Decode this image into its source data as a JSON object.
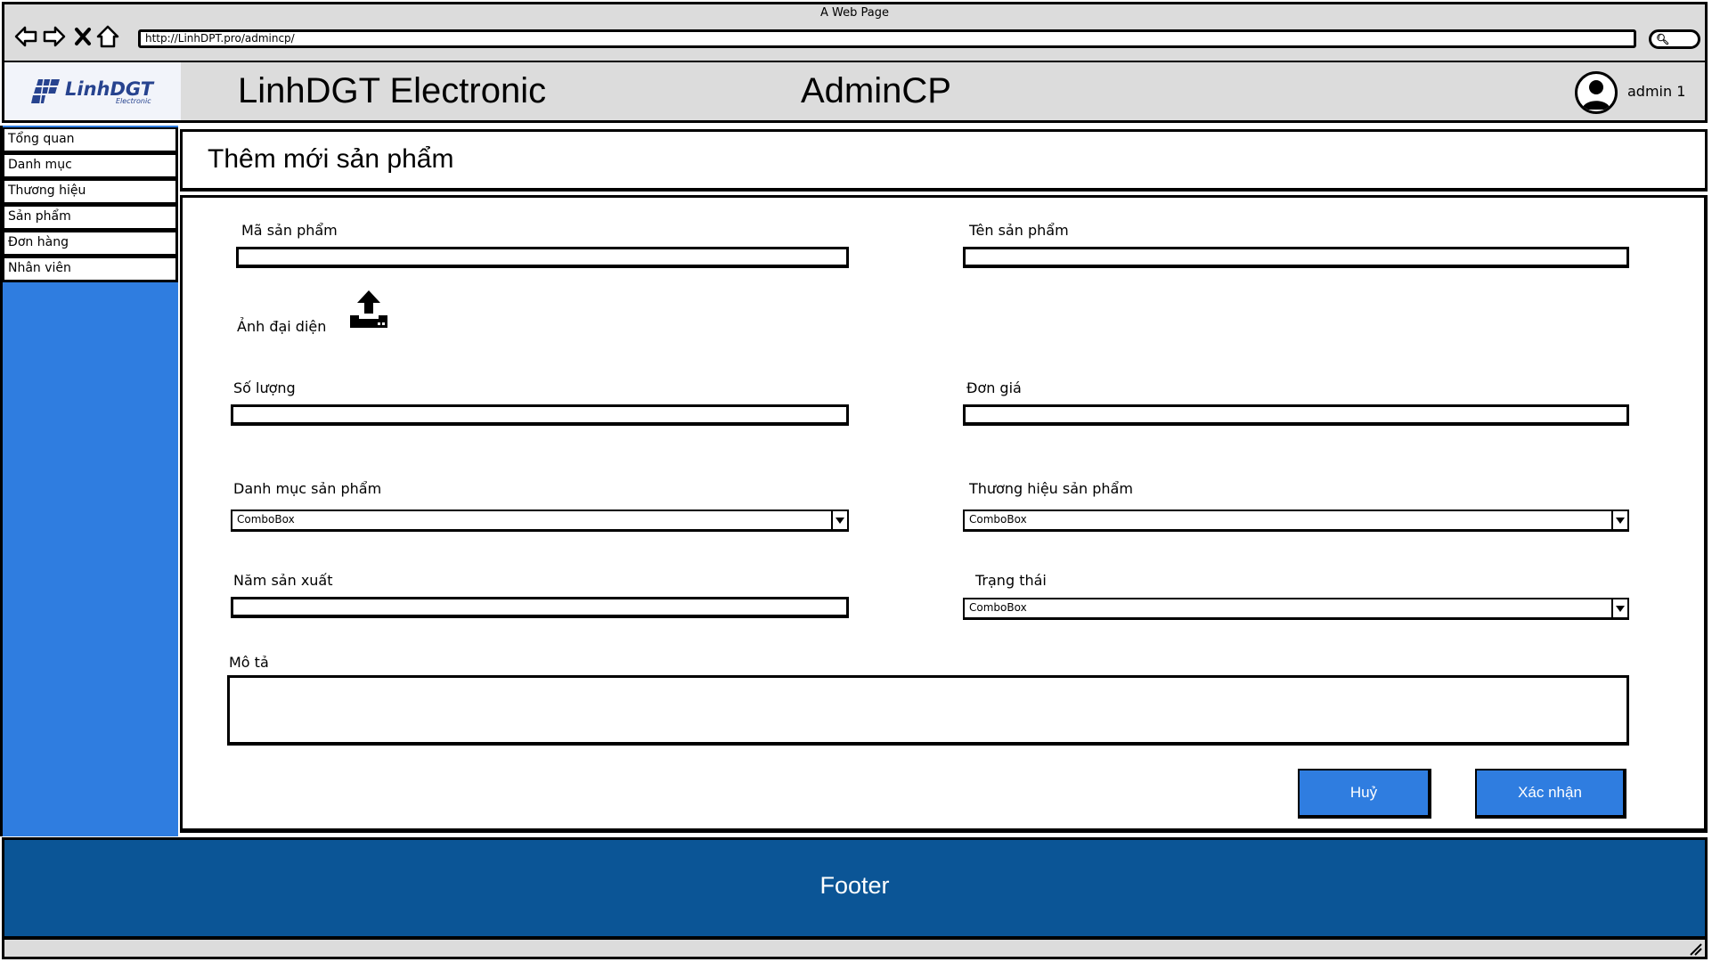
{
  "browser": {
    "window_title": "A Web Page",
    "url": "http://LinhDPT.pro/admincp/"
  },
  "header": {
    "logo_text": "LinhDGT",
    "logo_subtext": "Electronic",
    "site_name": "LinhDGT Electronic",
    "admin_title": "AdminCP",
    "user_name": "admin 1"
  },
  "sidebar": {
    "items": [
      {
        "label": "Tổng quan"
      },
      {
        "label": "Danh mục"
      },
      {
        "label": "Thương hiệu"
      },
      {
        "label": "Sản phẩm"
      },
      {
        "label": "Đơn hàng"
      },
      {
        "label": "Nhân viên"
      }
    ]
  },
  "page": {
    "title": "Thêm mới sản phẩm"
  },
  "form": {
    "product_code_label": "Mã sản phẩm",
    "product_name_label": "Tên sản phẩm",
    "avatar_label": "Ảnh đại diện",
    "quantity_label": "Số lượng",
    "price_label": "Đơn giá",
    "category_label": "Danh mục sản phẩm",
    "category_value": "ComboBox",
    "brand_label": "Thương hiệu sản phẩm",
    "brand_value": "ComboBox",
    "year_label": "Năm sản xuất",
    "status_label": "Trạng thái",
    "status_value": "ComboBox",
    "description_label": "Mô tả",
    "cancel_label": "Huỷ",
    "confirm_label": "Xác nhận"
  },
  "footer": {
    "text": "Footer"
  },
  "icons": {
    "back": "back-arrow-icon",
    "forward": "forward-arrow-icon",
    "close": "close-icon",
    "home": "home-icon",
    "search": "search-icon",
    "avatar": "user-avatar-icon",
    "upload": "upload-icon",
    "combo_arrow": "chevron-down-icon",
    "resize": "resize-grip-icon"
  },
  "colors": {
    "sidebar_bg": "#2f7de0",
    "footer_bg": "#0b5596",
    "chrome_bg": "#dcdcdc",
    "button_bg": "#2f7de0",
    "logo_color": "#27438f"
  }
}
